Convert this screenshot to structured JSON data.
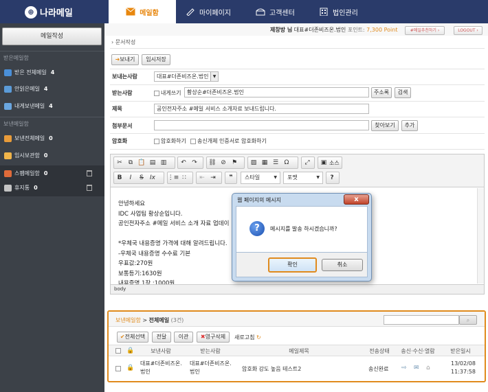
{
  "app": {
    "logo": "나라메일"
  },
  "sidebar": {
    "compose_label": "메일작성",
    "section_received": "받은메일함",
    "section_sent": "보낸메일함",
    "items": [
      {
        "label": "받은 전체메일",
        "count": "4"
      },
      {
        "label": "안읽은메일",
        "count": "4"
      },
      {
        "label": "내게보낸메일",
        "count": "4"
      },
      {
        "label": "보낸전체메일",
        "count": "0"
      },
      {
        "label": "임시보관함",
        "count": "0"
      },
      {
        "label": "스팸메일함",
        "count": "0"
      },
      {
        "label": "휴지통",
        "count": "0"
      }
    ]
  },
  "topnav": {
    "tabs": [
      {
        "label": "메일함"
      },
      {
        "label": "마이페이지"
      },
      {
        "label": "고객센터"
      },
      {
        "label": "법인관리"
      }
    ]
  },
  "userbar": {
    "user": "제창방 님",
    "org": "대표#더존비즈온.법인",
    "points_label": "포인트:",
    "points_value": "7,300 Point",
    "recommend_btn": "#메일추천하기 ›",
    "logout_btn": "LOGOUT ›"
  },
  "breadcrumb": "› 문서작성",
  "toolbar": {
    "send_label": "보내기",
    "draft_label": "임시저장"
  },
  "form": {
    "sender_label": "보내는사람",
    "sender_value": "대표#더존비즈온.법인",
    "recipient_label": "받는사람",
    "self_send_label": "내게쓰기",
    "recipient_value": "황상순#더존비즈온.법인",
    "address_book_btn": "주소록",
    "check_btn": "검색",
    "subject_label": "제목",
    "subject_value": "공인전자주소 #메일 서비스 소개자료 보내드립니다.",
    "attach_label": "첨부문서",
    "browse_btn": "찾아보기",
    "add_btn": "추가",
    "encrypt_label": "암호화",
    "encrypt_opt1": "암호화하기",
    "encrypt_opt2": "송신개체 인증서로 암호화하기"
  },
  "editor": {
    "source_label": "소스",
    "style_label": "스타일",
    "format_label": "포맷",
    "body_lines": [
      "안녕하세요",
      "IDC 사업팀 황상순입니다.",
      "공인전자주소 #메일 서비스 소개 자료 업데이",
      "",
      "*우체국 내용증명 가격에 대해 알려드립니다.",
      "-우체국 내용증명 수수료 기본",
      "우표값:270원",
      "보통등기:1630원",
      "내용증명 1장 :1000원"
    ],
    "status_path": "body"
  },
  "dialog": {
    "title": "웹 페이지의 메시지",
    "close": "x",
    "message": "메시지를 발송 하시겠습니까?",
    "ok_label": "확인",
    "cancel_label": "취소"
  },
  "list_panel": {
    "breadcrumb_parent": "보낸메일함",
    "breadcrumb_sep": ">",
    "breadcrumb_current": "전체메일",
    "count": "(3건)",
    "select_all": "전체선택",
    "forward": "전달",
    "move": "이관",
    "delete_perm": "영구삭제",
    "refresh": "새로고침",
    "columns": [
      "보낸사람",
      "받는사람",
      "메일제목",
      "전송상태",
      "송신·수신·열람",
      "받은일시"
    ],
    "rows": [
      {
        "sender_line1": "대표#더존비즈온.",
        "sender_line2": "법인",
        "recipient_line1": "대표#더존비즈온.",
        "recipient_line2": "법인",
        "subject": "암호화 강도 높음 테스트2",
        "status": "송신완료",
        "date": "13/02/08",
        "time": "11:37:58"
      }
    ]
  }
}
